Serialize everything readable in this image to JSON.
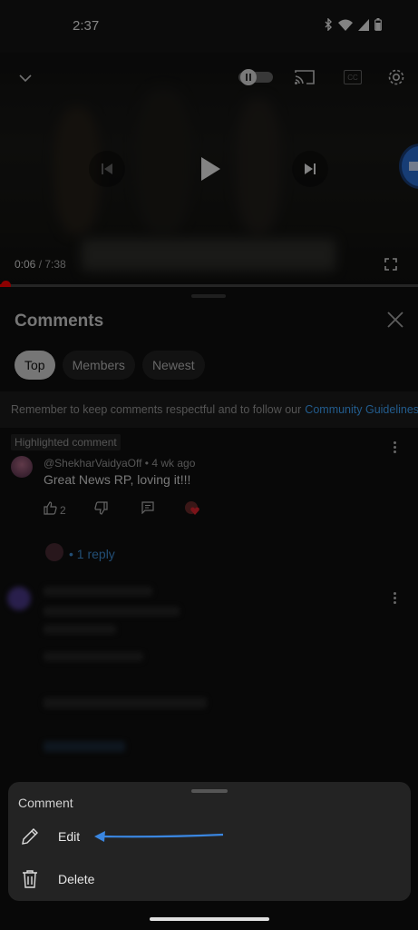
{
  "status_bar": {
    "time": "2:37"
  },
  "player": {
    "current_time": "0:06",
    "separator": " / ",
    "duration": "7:38",
    "progress_fraction": 0.013,
    "cc_label": "CC"
  },
  "comments": {
    "title": "Comments",
    "filters": [
      {
        "label": "Top",
        "active": true
      },
      {
        "label": "Members",
        "active": false
      },
      {
        "label": "Newest",
        "active": false
      }
    ],
    "notice_text": "Remember to keep comments respectful and to follow our",
    "notice_link": "Community Guidelines",
    "highlighted_badge": "Highlighted comment",
    "highlighted_comment": {
      "author": "@ShekharVaidyaOff",
      "age": " • 4 wk ago",
      "text": "Great News RP, loving it!!!",
      "likes": "2",
      "replies": "• 1 reply"
    }
  },
  "sheet_menu": {
    "title": "Comment",
    "items": [
      {
        "label": "Edit",
        "icon": "pencil-icon"
      },
      {
        "label": "Delete",
        "icon": "trash-icon"
      }
    ]
  },
  "colors": {
    "accent_link": "#3e8ed6",
    "progress": "#ff0000",
    "arrow": "#3a86e0"
  }
}
